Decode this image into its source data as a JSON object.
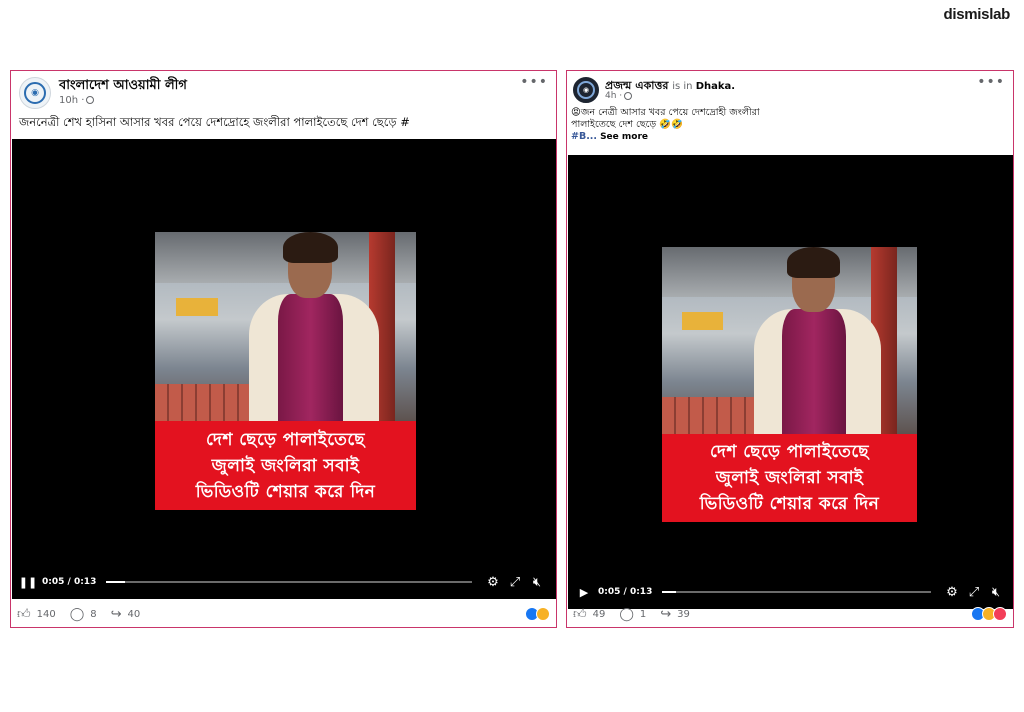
{
  "brand": "dismislab",
  "posts": [
    {
      "page_name": "বাংলাদেশ আওয়ামী লীগ",
      "location_prefix": "",
      "location": "",
      "time": "10h ·",
      "caption_line1": "জননেত্রী শেখ হাসিনা আসার খবর পেয়ে দেশদ্রোহে জংলীরা পালাইতেছে দেশ ছেড়ে #",
      "caption_line2": "",
      "hashtag": "",
      "see_more": "",
      "overlay_lines": [
        "দেশ ছেড়ে পালাইতেছে",
        "জুলাই জংলিরা সবাই",
        "ভিডিওটি শেয়ার করে দিন"
      ],
      "play_state": "pause",
      "elapsed": "0:05 / 0:13",
      "progress": 0.05,
      "likes": "140",
      "comments": "8",
      "shares": "40"
    },
    {
      "page_name": "প্রজন্ম একাত্তর",
      "location_prefix": "is in",
      "location": "Dhaka.",
      "time": "4h ·",
      "caption_line1": "😡জন নেত্রী আসার খবর পেয়ে দেশদ্রোহী জংলীরা",
      "caption_line2": "পালাইতেছে দেশ ছেড়ে 🤣🤣",
      "hashtag": "#B...",
      "see_more": "See more",
      "overlay_lines": [
        "দেশ ছেড়ে পালাইতেছে",
        "জুলাই জংলিরা সবাই",
        "ভিডিওটি শেয়ার করে দিন"
      ],
      "play_state": "play",
      "elapsed": "0:05 / 0:13",
      "progress": 0.05,
      "likes": "49",
      "comments": "1",
      "shares": "39"
    }
  ],
  "icons": {
    "more": "more-options-icon",
    "globe": "globe-icon",
    "settings": "gear-icon",
    "fullscreen": "fullscreen-icon",
    "mute": "mute-icon",
    "like": "like-icon",
    "comment": "comment-icon",
    "share": "share-icon"
  },
  "colors": {
    "post_border": "#c9356a",
    "overlay_red": "#e3121f",
    "video_bg": "#000000",
    "facebook_blue": "#1877f2"
  }
}
